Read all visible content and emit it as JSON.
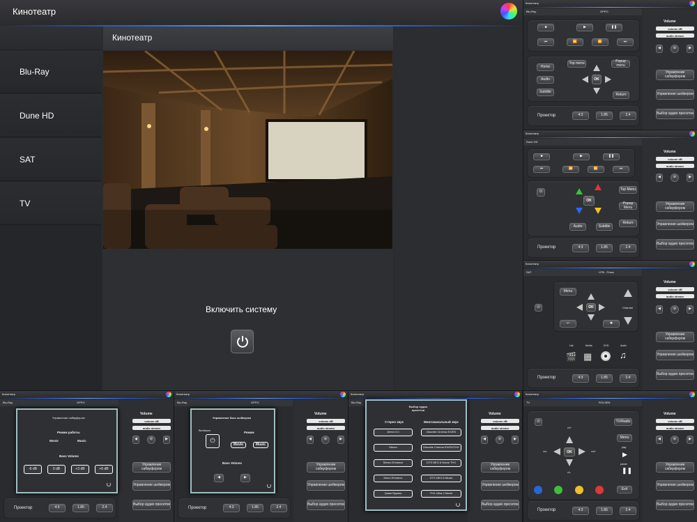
{
  "main": {
    "title": "Кинотеатр",
    "sidebar": [
      "Blu-Ray",
      "Dune HD",
      "SAT",
      "TV"
    ],
    "content_title": "Кинотеатр",
    "power_label": "Включить систему"
  },
  "common": {
    "app_title": "Кинотеатр",
    "volume": "Volume",
    "volume_db": "volume dB",
    "audio_stream": "audio stream",
    "sub_ctrl": "Управление сабвуфером",
    "shaker_ctrl": "Управление шейкером",
    "presets": "Выбор аудио пресетов",
    "projector": "Проектор",
    "ratios": [
      "4:3",
      "1.85",
      "2.4"
    ]
  },
  "bluray": {
    "source": "Blu-Ray",
    "device": "OPPO",
    "home": "Home",
    "audio": "Audio",
    "subtitle": "Subtitle",
    "top_menu": "Top menu",
    "popup": "Popup menu",
    "ok": "OK",
    "return": "Return"
  },
  "dune": {
    "source": "Dune HD",
    "top_menu": "Top Menu",
    "popup": "Popup Menu",
    "ok": "OK",
    "return": "Return",
    "audio": "Audio",
    "subtitle": "Subtitle"
  },
  "sat": {
    "source": "SAT",
    "device": "НТВ - Плюс",
    "menu": "Menu",
    "ok": "OK",
    "channel": "Channel",
    "icons": [
      "List",
      "Media",
      "DVD",
      "Audio"
    ]
  },
  "sub_modal": {
    "title": "Управление сабвуфером",
    "mode_title": "Режим работы",
    "modes": [
      "Movie",
      "Music"
    ],
    "bass_title": "Bass Volume",
    "bass": [
      "-6 dB",
      "0 dB",
      "+3 dB",
      "+6 dB"
    ]
  },
  "shaker_modal": {
    "title": "Управление басс шейкером",
    "switch": "Вкл/выкл",
    "mode_title": "Режим",
    "modes": [
      "Movie",
      "Music"
    ],
    "bass_title": "Bass Volume"
  },
  "preset_modal": {
    "title": "Выбор аудио пресетов",
    "stereo_title": "Стерео звук",
    "multi_title": "Многоканальный звук",
    "stereo": [
      "Direct 2.0",
      "Stereo",
      "Stereo Enhance",
      "Mono Enhance",
      "Quasi Bypass"
    ],
    "multi": [
      "Discrete Cinema EX/ES",
      "Discrete Cinema EX/ES/THX",
      "DTS NEO 6 Movie THX",
      "DTS NEO 6 Music",
      "THX Ultra 2 Movie"
    ]
  },
  "tv": {
    "source": "TV",
    "device": "ROLSEN",
    "tvradio": "TV/Radio",
    "menu": "Menu",
    "ok": "OK",
    "ch_up": "ch+",
    "ch_down": "ch-",
    "vol_down": "vol-",
    "vol_up": "vol+",
    "play": "play",
    "pause": "pause",
    "exit": "Exit"
  }
}
